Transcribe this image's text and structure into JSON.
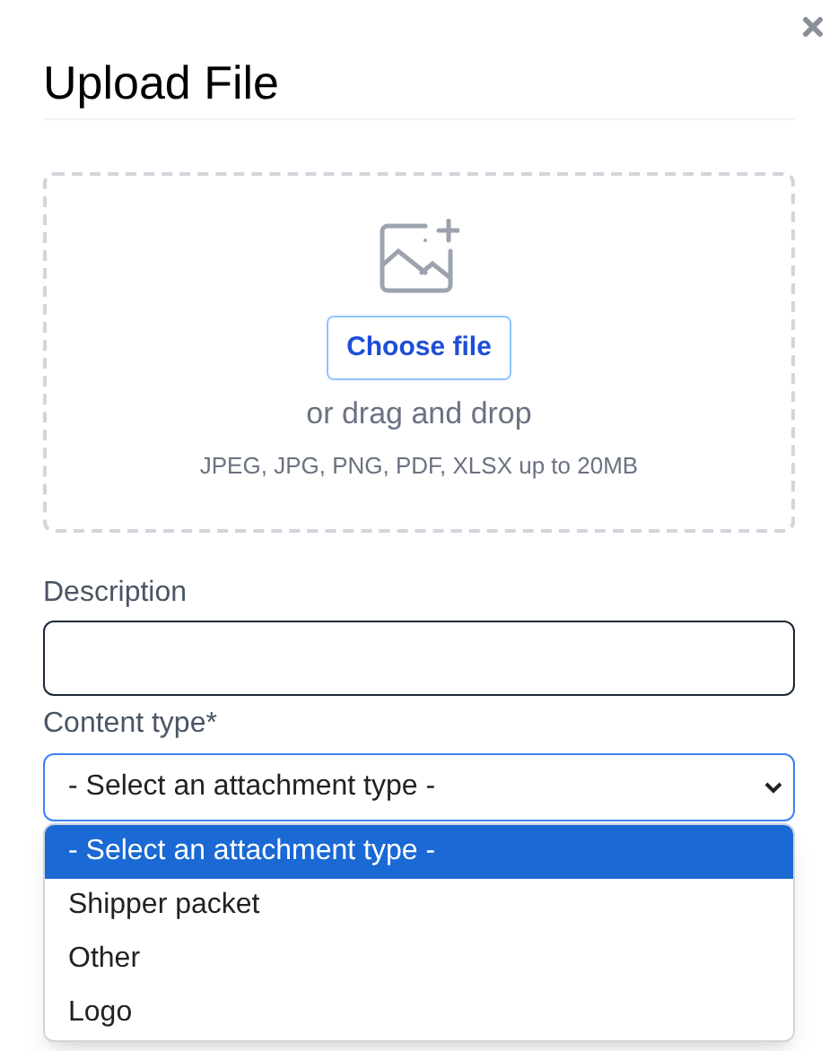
{
  "dialog": {
    "title": "Upload File"
  },
  "dropzone": {
    "button": "Choose file",
    "hint": "or drag and drop",
    "formats": "JPEG, JPG, PNG, PDF, XLSX up to 20MB"
  },
  "description": {
    "label": "Description"
  },
  "content_type": {
    "label": "Content type*",
    "value": "- Select an attachment type -",
    "expanded": true,
    "options": [
      {
        "label": "- Select an attachment type -",
        "selected": true
      },
      {
        "label": "Shipper packet",
        "selected": false
      },
      {
        "label": "Other",
        "selected": false
      },
      {
        "label": "Logo",
        "selected": false
      }
    ]
  }
}
